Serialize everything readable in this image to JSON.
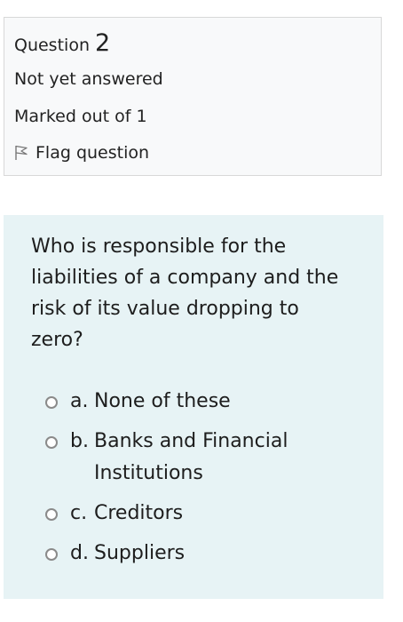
{
  "info": {
    "question_word": "Question",
    "question_number": "2",
    "state": "Not yet answered",
    "grade": "Marked out of 1",
    "flag_label": "Flag question",
    "flag_icon": "flag-outline-icon"
  },
  "question": {
    "text": "Who is responsible for the liabilities of a company and the risk of its value dropping to zero?"
  },
  "answers": [
    {
      "letter": "a.",
      "label": "None of these",
      "selected": false
    },
    {
      "letter": "b.",
      "label": "Banks and Financial Institutions",
      "selected": false
    },
    {
      "letter": "c.",
      "label": "Creditors",
      "selected": false
    },
    {
      "letter": "d.",
      "label": "Suppliers",
      "selected": false
    }
  ],
  "colors": {
    "info_background": "#f8f9fa",
    "content_background": "#e7f3f5",
    "text": "#1d1d1d",
    "radio_border": "#8a8a8a"
  }
}
